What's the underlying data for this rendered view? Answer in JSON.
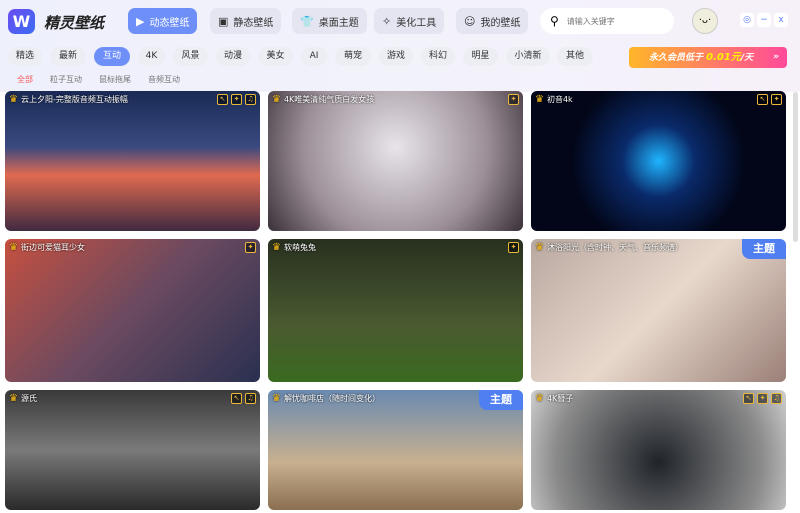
{
  "app": {
    "logo": "W",
    "name": "精灵壁纸"
  },
  "nav": [
    {
      "label": "动态壁纸",
      "icon": "play-icon"
    },
    {
      "label": "静态壁纸",
      "icon": "image-icon"
    },
    {
      "label": "桌面主题",
      "icon": "shirt-icon"
    },
    {
      "label": "美化工具",
      "icon": "tool-icon"
    },
    {
      "label": "我的壁纸",
      "icon": "smile-icon"
    }
  ],
  "search": {
    "placeholder": "请输入关键字"
  },
  "window": {
    "settings": "◎",
    "minimize": "−",
    "close": "x"
  },
  "categories": [
    "精选",
    "最新",
    "互动",
    "4K",
    "风景",
    "动漫",
    "美女",
    "AI",
    "萌宠",
    "游戏",
    "科幻",
    "明星",
    "小清新",
    "其他"
  ],
  "active_category": "互动",
  "promo": {
    "text": "永久会员低于",
    "price": "0.01元",
    "unit": "/天",
    "arrow": "»"
  },
  "subcategories": [
    "全部",
    "粒子互动",
    "鼠标拖尾",
    "音频互动"
  ],
  "active_subcategory": "全部",
  "theme_badge": "主题",
  "cards": [
    {
      "title": "云上夕阳-完整版音频互动振幅",
      "badges": [
        "mouse",
        "particle",
        "music"
      ]
    },
    {
      "title": "4K唯美清纯气质白发女孩",
      "badges": [
        "particle"
      ]
    },
    {
      "title": "初音4k",
      "badges": [
        "mouse",
        "particle"
      ]
    },
    {
      "title": "街边可爱猫耳少女",
      "badges": [
        "particle"
      ]
    },
    {
      "title": "软萌兔兔",
      "badges": [
        "particle"
      ]
    },
    {
      "title": "沐浴阳光（含时钟、天气、音乐频谱）",
      "badges": [],
      "theme": true
    },
    {
      "title": "源氏",
      "badges": [
        "mouse",
        "music"
      ]
    },
    {
      "title": "解忧咖啡店（随时间变化）",
      "badges": [],
      "theme": true
    },
    {
      "title": "4K簪子",
      "badges": [
        "mouse",
        "particle",
        "music"
      ]
    }
  ]
}
